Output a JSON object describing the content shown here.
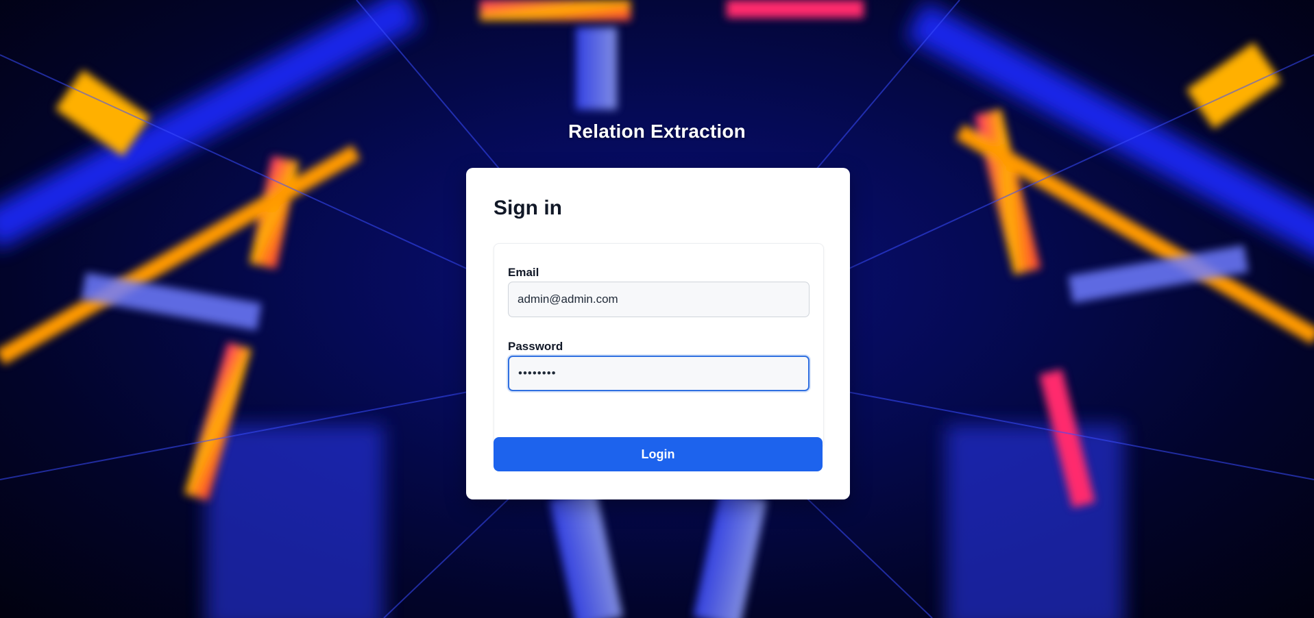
{
  "app": {
    "title": "Relation Extraction"
  },
  "signin": {
    "heading": "Sign in",
    "email_label": "Email",
    "email_value": "admin@admin.com",
    "password_label": "Password",
    "password_value": "••••••••",
    "login_label": "Login"
  },
  "colors": {
    "accent": "#1d63ed",
    "focus_ring": "#2f6fe0",
    "card_bg": "#ffffff",
    "background_dark": "#050a55"
  }
}
